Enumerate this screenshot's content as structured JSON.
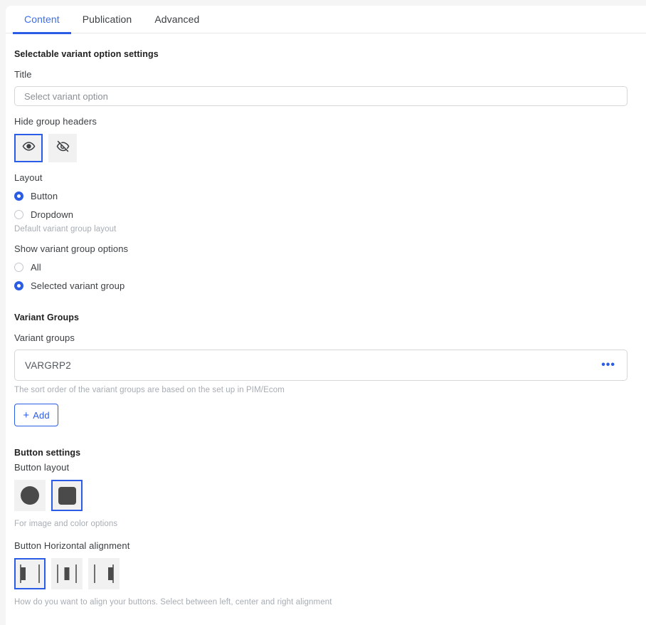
{
  "tabs": [
    {
      "label": "Content",
      "active": true
    },
    {
      "label": "Publication",
      "active": false
    },
    {
      "label": "Advanced",
      "active": false
    }
  ],
  "selectable_variant": {
    "section_title": "Selectable variant option settings",
    "title_label": "Title",
    "title_value": "",
    "title_placeholder": "Select variant option"
  },
  "hide_group_headers": {
    "label": "Hide group headers",
    "options": [
      {
        "icon": "eye-visible-icon",
        "selected": true
      },
      {
        "icon": "eye-hidden-icon",
        "selected": false
      }
    ]
  },
  "layout": {
    "label": "Layout",
    "options": [
      {
        "label": "Button",
        "selected": true
      },
      {
        "label": "Dropdown",
        "selected": false
      }
    ],
    "helper": "Default variant group layout"
  },
  "show_variant_group_options": {
    "label": "Show variant group options",
    "options": [
      {
        "label": "All",
        "selected": false
      },
      {
        "label": "Selected variant group",
        "selected": true
      }
    ]
  },
  "variant_groups": {
    "section_title": "Variant Groups",
    "field_label": "Variant groups",
    "value": "VARGRP2",
    "menu_icon": "•••",
    "helper": "The sort order of the variant groups are based on the set up in PIM/Ecom",
    "add_button": {
      "plus": "+",
      "label": "Add"
    }
  },
  "button_settings": {
    "section_title": "Button settings",
    "layout_label": "Button layout",
    "layout_options": [
      {
        "icon": "circle-shape-icon",
        "selected": false
      },
      {
        "icon": "square-shape-icon",
        "selected": true
      }
    ],
    "layout_helper": "For image and color options",
    "alignment_label": "Button Horizontal alignment",
    "alignment_options": [
      {
        "icon": "align-left-icon",
        "selected": true
      },
      {
        "icon": "align-center-icon",
        "selected": false
      },
      {
        "icon": "align-right-icon",
        "selected": false
      }
    ],
    "alignment_helper": "How do you want to align your buttons. Select between left, center and right alignment"
  },
  "colors": {
    "accent": "#2b5ce6",
    "tab_active": "#3b6ef0",
    "text": "#3c4043",
    "helper_text": "#a7adb4",
    "shape_fill": "#4a4a4a"
  }
}
